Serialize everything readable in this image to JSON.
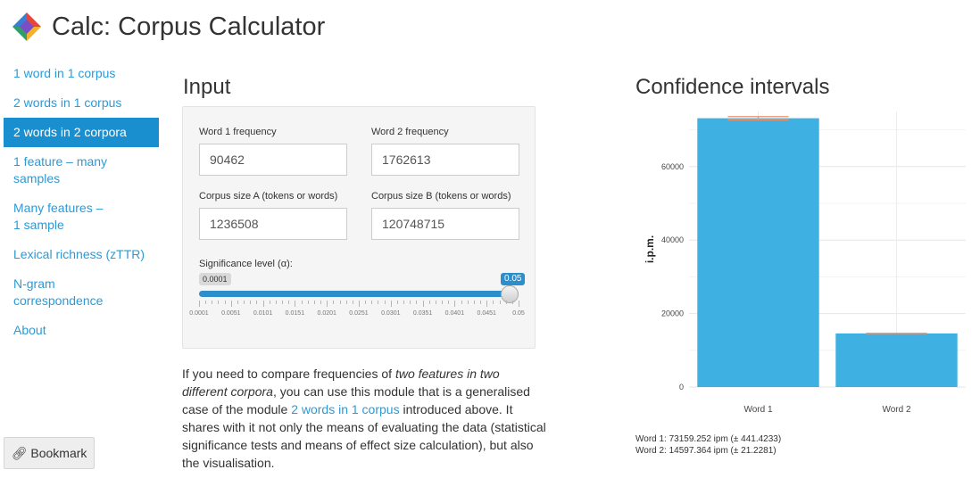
{
  "app": {
    "title": "Calc: Corpus Calculator",
    "logo_icon": "diamond-logo-icon"
  },
  "sidebar": {
    "items": [
      {
        "label": "1 word in 1 corpus",
        "active": false
      },
      {
        "label": "2 words in 1 corpus",
        "active": false
      },
      {
        "label": "2 words in 2 corpora",
        "active": true
      },
      {
        "label": "1 feature – many samples",
        "active": false
      },
      {
        "label": "Many features – 1 sample",
        "active": false
      },
      {
        "label": "Lexical richness (zTTR)",
        "active": false
      },
      {
        "label": "N-gram correspondence",
        "active": false
      },
      {
        "label": "About",
        "active": false
      }
    ],
    "bookmark_label": "Bookmark",
    "bookmark_icon": "link-icon"
  },
  "input": {
    "heading": "Input",
    "word1_label": "Word 1 frequency",
    "word1_value": "90462",
    "word2_label": "Word 2 frequency",
    "word2_value": "1762613",
    "corpus_a_label": "Corpus size A (tokens or words)",
    "corpus_a_value": "1236508",
    "corpus_b_label": "Corpus size B (tokens or words)",
    "corpus_b_value": "120748715",
    "slider": {
      "label": "Significance level (α):",
      "min_label": "0.0001",
      "value_label": "0.05",
      "value": 0.05,
      "min": 0.0001,
      "max": 0.05,
      "ticks": [
        "0.0001",
        "0.0051",
        "0.0101",
        "0.0151",
        "0.0201",
        "0.0251",
        "0.0301",
        "0.0351",
        "0.0401",
        "0.0451",
        "0.05"
      ]
    }
  },
  "description": {
    "part1": "If you need to compare frequencies of ",
    "emphasis": "two features in two different corpora",
    "part2": ", you can use this module that is a generalised case of the module ",
    "link": "2 words in 1 corpus",
    "part3": " introduced above. It shares with it not only the means of evaluating the data (statistical significance tests and means of effect size calculation), but also the visualisation."
  },
  "chart_heading": "Confidence intervals",
  "chart_data": {
    "type": "bar",
    "categories": [
      "Word 1",
      "Word 2"
    ],
    "values": [
      73159.252,
      14597.364
    ],
    "errors": [
      441.4233,
      21.2281
    ],
    "xlabel": "",
    "ylabel": "i.p.m.",
    "ylim": [
      0,
      75000
    ],
    "yticks": [
      0,
      20000,
      40000,
      60000
    ],
    "bar_color": "#3fb0e2",
    "error_color": "#e8956f",
    "grid": true
  },
  "stats": {
    "line1": "Word 1: 73159.252 ipm (± 441.4233)",
    "line2": "Word 2: 14597.364 ipm (± 21.2281)"
  }
}
